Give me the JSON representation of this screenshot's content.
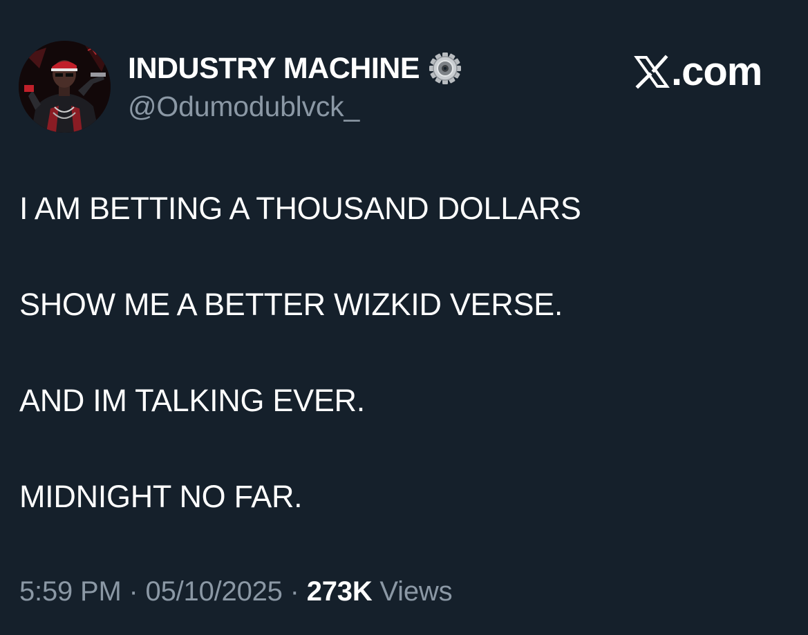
{
  "author": {
    "display_name": "INDUSTRY MACHINE",
    "handle": "@Odumodublvck_",
    "badge_icon": "gear-icon",
    "avatar_icon": "profile-photo"
  },
  "brand": {
    "label": ".com",
    "icon": "x-logo-icon"
  },
  "post": {
    "lines": [
      "I AM BETTING A THOUSAND DOLLARS",
      "SHOW ME A BETTER WIZKID VERSE.",
      "AND IM TALKING EVER.",
      "MIDNIGHT NO FAR."
    ]
  },
  "meta": {
    "time": "5:59 PM",
    "separator": " · ",
    "date": "05/10/2025",
    "views_count": "273K",
    "views_label": " Views"
  },
  "colors": {
    "background": "#15202b",
    "text_primary": "#ffffff",
    "text_secondary": "#8b98a5",
    "badge_gray": "#b8bcc0"
  }
}
